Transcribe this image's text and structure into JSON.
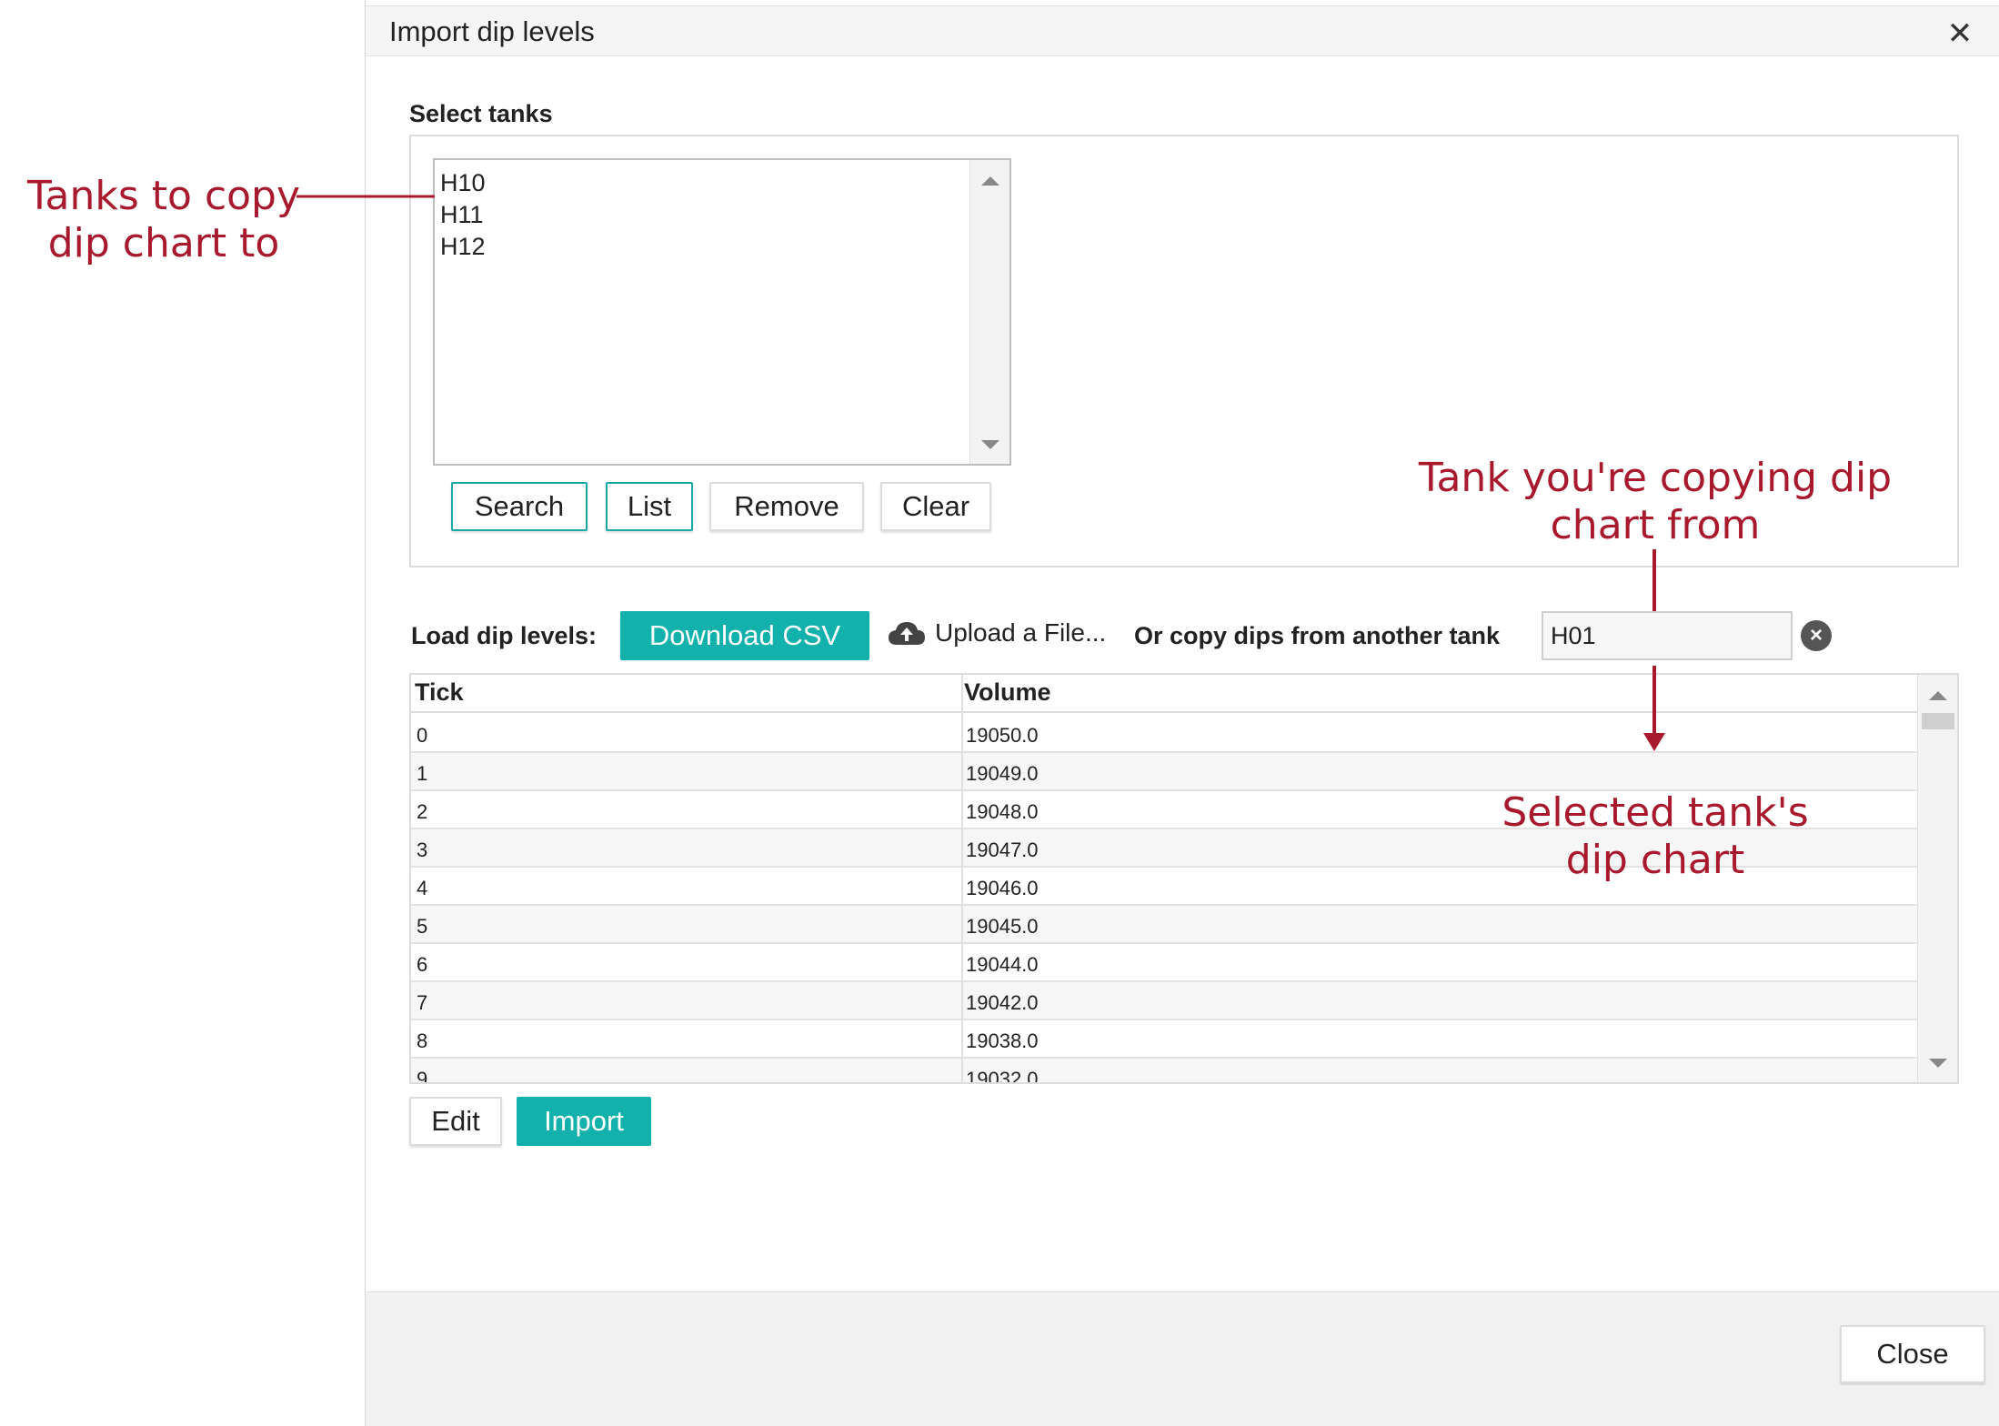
{
  "dialog": {
    "title": "Import dip levels",
    "close_icon": "close-icon"
  },
  "select_tanks": {
    "label": "Select tanks",
    "items": [
      "H10",
      "H11",
      "H12"
    ],
    "buttons": {
      "search": "Search",
      "list": "List",
      "remove": "Remove",
      "clear": "Clear"
    }
  },
  "load": {
    "label": "Load dip levels:",
    "download_csv": "Download CSV",
    "upload_file": "Upload a File...",
    "upload_icon": "cloud-upload-icon",
    "copy_label": "Or copy dips from another tank",
    "copy_value": "H01",
    "clear_icon": "clear-circle-icon"
  },
  "table": {
    "headers": [
      "Tick",
      "Volume"
    ],
    "rows": [
      [
        "0",
        "19050.0"
      ],
      [
        "1",
        "19049.0"
      ],
      [
        "2",
        "19048.0"
      ],
      [
        "3",
        "19047.0"
      ],
      [
        "4",
        "19046.0"
      ],
      [
        "5",
        "19045.0"
      ],
      [
        "6",
        "19044.0"
      ],
      [
        "7",
        "19042.0"
      ],
      [
        "8",
        "19038.0"
      ],
      [
        "9",
        "19032.0"
      ]
    ]
  },
  "actions": {
    "edit": "Edit",
    "import": "Import",
    "close": "Close"
  },
  "annotations": {
    "tanks_to": "Tanks to copy\ndip chart to",
    "tank_from": "Tank you're copying dip\nchart from",
    "selected_chart": "Selected tank's\ndip chart"
  },
  "colors": {
    "accent": "#13b1ac",
    "annotation": "#a8192e"
  }
}
